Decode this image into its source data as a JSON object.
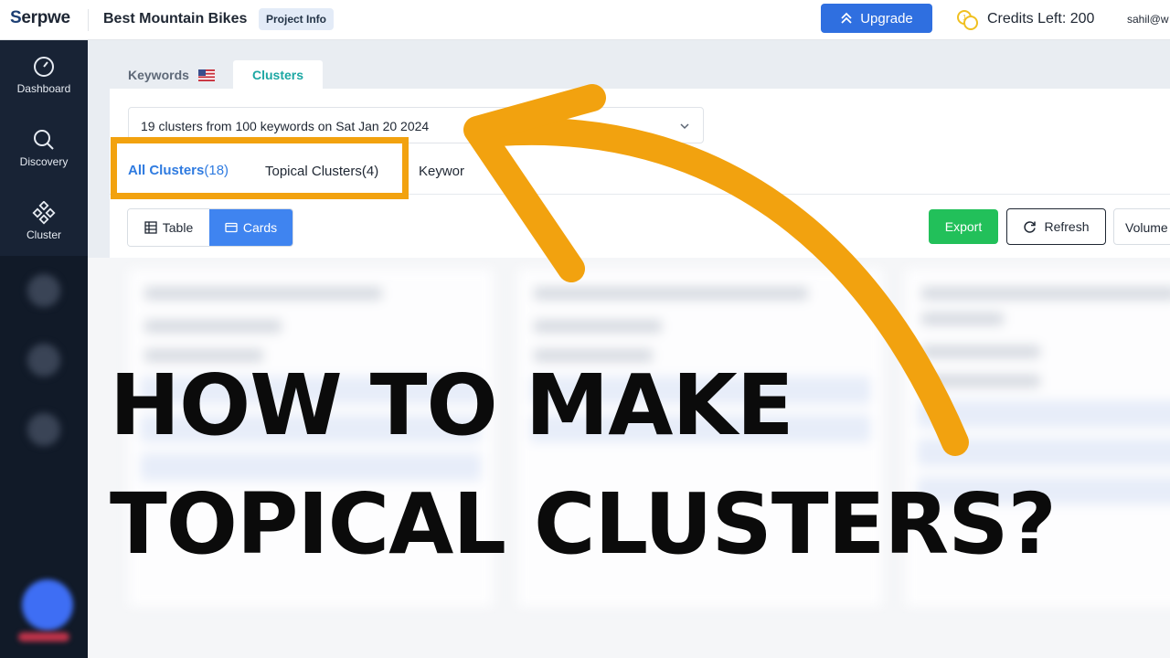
{
  "header": {
    "logo_text": "erpwe",
    "logo_initial": "S",
    "project_title": "Best Mountain Bikes",
    "project_info_label": "Project Info",
    "upgrade_label": "Upgrade",
    "credits_label": "Credits Left: 200",
    "user_label": "sahil@w"
  },
  "sidebar": {
    "items": [
      {
        "label": "Dashboard",
        "icon": "gauge-icon"
      },
      {
        "label": "Discovery",
        "icon": "search-icon"
      },
      {
        "label": "Cluster",
        "icon": "cluster-icon"
      }
    ]
  },
  "tabs": {
    "keywords_label": "Keywords",
    "clusters_label": "Clusters"
  },
  "main": {
    "select_value": "19 clusters from 100 keywords on Sat Jan 20 2024",
    "subtabs": {
      "all_label": "All Clusters",
      "all_count": "(18)",
      "topical_label": "Topical Clusters(4)",
      "keywords_partial": "Keywor"
    },
    "view_toggle": {
      "table_label": "Table",
      "cards_label": "Cards"
    },
    "buttons": {
      "export_label": "Export",
      "refresh_label": "Refresh",
      "volume_label": "Volume"
    }
  },
  "overlay": {
    "line1": "HOW TO MAKE",
    "line2": "TOPICAL CLUSTERS?"
  },
  "colors": {
    "accent_blue": "#2f6fe0",
    "highlight_orange": "#f2a20f",
    "export_green": "#22c05a",
    "sidebar_bg": "#182335",
    "clusters_tab_teal": "#1ca7a3"
  }
}
